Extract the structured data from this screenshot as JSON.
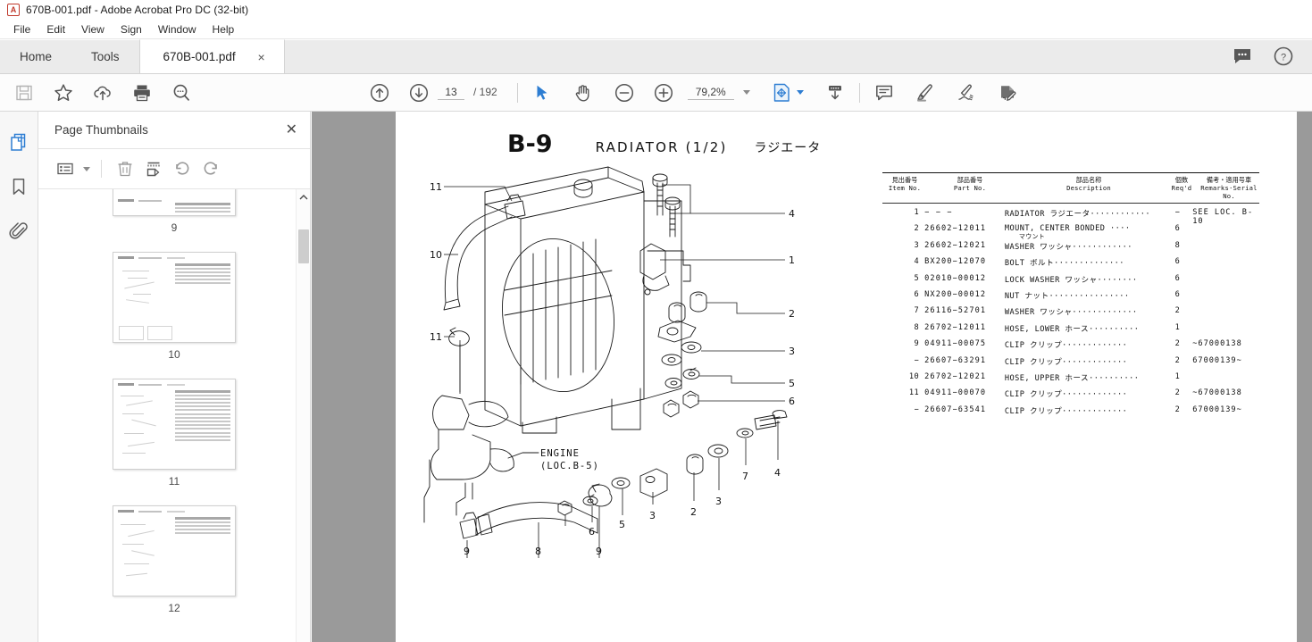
{
  "window": {
    "title": "670B-001.pdf - Adobe Acrobat Pro DC (32-bit)",
    "app_icon": "A"
  },
  "menu": {
    "items": [
      "File",
      "Edit",
      "View",
      "Sign",
      "Window",
      "Help"
    ]
  },
  "tabs": {
    "home": "Home",
    "tools": "Tools",
    "document": "670B-001.pdf",
    "close": "×",
    "right_icons": [
      "chat-icon",
      "help-icon"
    ]
  },
  "toolbar": {
    "left_icons": [
      "save-icon",
      "star-icon",
      "upload-cloud-icon",
      "print-icon",
      "search-icon"
    ],
    "prev_page_icon": "arrow-up-circle-icon",
    "next_page_icon": "arrow-down-circle-icon",
    "page_current": "13",
    "page_total": "/ 192",
    "select_icon": "cursor-icon",
    "hand_icon": "hand-icon",
    "zoom_out_icon": "zoom-out-icon",
    "zoom_in_icon": "zoom-in-icon",
    "zoom_level": "79,2%",
    "fit_page_icon": "fit-page-icon",
    "scroll_mode_icon": "scroll-down-icon",
    "comment_icon": "comment-icon",
    "highlight_icon": "highlighter-icon",
    "sign_icon": "sign-icon",
    "edit_pdf_icon": "edit-pdf-icon"
  },
  "rail": {
    "items": [
      "page-thumbnails-icon",
      "bookmarks-icon",
      "attachments-icon"
    ]
  },
  "thumbnails": {
    "panel_title": "Page Thumbnails",
    "close": "✕",
    "tools": [
      "options-list-icon",
      "delete-icon",
      "extract-pages-icon",
      "rotate-ccw-icon",
      "rotate-cw-icon"
    ],
    "pages": [
      {
        "number": "9"
      },
      {
        "number": "10"
      },
      {
        "number": "11"
      },
      {
        "number": "12"
      }
    ]
  },
  "document": {
    "page_code": "B-9",
    "page_name": "RADIATOR (1/2)",
    "page_name_jp": "ラジエータ",
    "drawing": {
      "engine_label_1": "ENGINE",
      "engine_label_2": "(LOC.B-5)",
      "callouts_left": [
        "11",
        "10",
        "11"
      ],
      "callouts_right": [
        "4",
        "1",
        "2",
        "3",
        "5",
        "6",
        "4"
      ],
      "callouts_bottom": [
        "9",
        "8",
        "9",
        "6",
        "5",
        "3",
        "2",
        "3",
        "7",
        "4"
      ]
    },
    "table": {
      "headers": [
        {
          "jp": "見出番号",
          "en": "Item No."
        },
        {
          "jp": "部品番号",
          "en": "Part No."
        },
        {
          "jp": "部品名称",
          "en": "Description"
        },
        {
          "jp": "個数",
          "en": "Req'd"
        },
        {
          "jp": "備考・適用号車",
          "en": "Remarks·Serial No."
        }
      ],
      "rows": [
        {
          "item": "1",
          "part": "− − −",
          "desc": "RADIATOR ラジエータ············",
          "jpsub": "",
          "req": "−",
          "rem": "SEE LOC. B-10"
        },
        {
          "item": "2",
          "part": "26602−12011",
          "desc": "MOUNT, CENTER BONDED ····",
          "jpsub": "マウント",
          "req": "6",
          "rem": ""
        },
        {
          "item": "3",
          "part": "26602−12021",
          "desc": "WASHER ワッシャ············",
          "jpsub": "",
          "req": "8",
          "rem": ""
        },
        {
          "item": "4",
          "part": "BX200−12070",
          "desc": "BOLT ボルト··············",
          "jpsub": "",
          "req": "6",
          "rem": ""
        },
        {
          "item": "5",
          "part": "02010−00012",
          "desc": "LOCK WASHER ワッシャ········",
          "jpsub": "",
          "req": "6",
          "rem": ""
        },
        {
          "item": "6",
          "part": "NX200−00012",
          "desc": "NUT ナット················",
          "jpsub": "",
          "req": "6",
          "rem": ""
        },
        {
          "item": "7",
          "part": "26116−52701",
          "desc": "WASHER ワッシャ·············",
          "jpsub": "",
          "req": "2",
          "rem": ""
        },
        {
          "item": "8",
          "part": "26702−12011",
          "desc": "HOSE, LOWER ホース··········",
          "jpsub": "",
          "req": "1",
          "rem": ""
        },
        {
          "item": "9",
          "part": "04911−00075",
          "desc": "CLIP クリップ·············",
          "jpsub": "",
          "req": "2",
          "rem": "~67000138"
        },
        {
          "item": "−",
          "part": "26607−63291",
          "desc": "CLIP クリップ·············",
          "jpsub": "",
          "req": "2",
          "rem": "67000139~"
        },
        {
          "item": "10",
          "part": "26702−12021",
          "desc": "HOSE, UPPER ホース··········",
          "jpsub": "",
          "req": "1",
          "rem": ""
        },
        {
          "item": "11",
          "part": "04911−00070",
          "desc": "CLIP クリップ·············",
          "jpsub": "",
          "req": "2",
          "rem": "~67000138"
        },
        {
          "item": "−",
          "part": "26607−63541",
          "desc": "CLIP クリップ·············",
          "jpsub": "",
          "req": "2",
          "rem": "67000139~"
        }
      ]
    }
  },
  "colors": {
    "accent_blue": "#2d7dd2",
    "doc_background": "#9a9a9a",
    "toolbar_bg": "#fcfcfc",
    "tab_bg": "#ebebeb"
  }
}
